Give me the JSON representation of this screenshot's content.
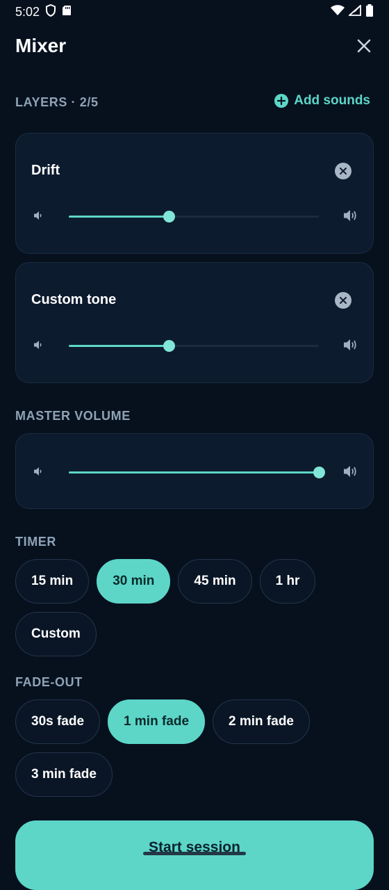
{
  "status_bar": {
    "time": "5:02"
  },
  "header": {
    "title": "Mixer"
  },
  "layers": {
    "label": "LAYERS · 2/5",
    "add_label": "Add sounds",
    "items": [
      {
        "name": "Drift",
        "volume": 0.4
      },
      {
        "name": "Custom tone",
        "volume": 0.4
      }
    ]
  },
  "master": {
    "label": "MASTER VOLUME",
    "volume": 1.0
  },
  "timer": {
    "label": "TIMER",
    "options": [
      "15 min",
      "30 min",
      "45 min",
      "1 hr",
      "Custom"
    ],
    "selected": "30 min"
  },
  "fade": {
    "label": "FADE-OUT",
    "options": [
      "30s fade",
      "1 min fade",
      "2 min fade",
      "3 min fade"
    ],
    "selected": "1 min fade"
  },
  "start_button": {
    "label": "Start session"
  },
  "colors": {
    "accent": "#5dd6c8",
    "background": "#07111e",
    "card": "#0d1b2e"
  }
}
